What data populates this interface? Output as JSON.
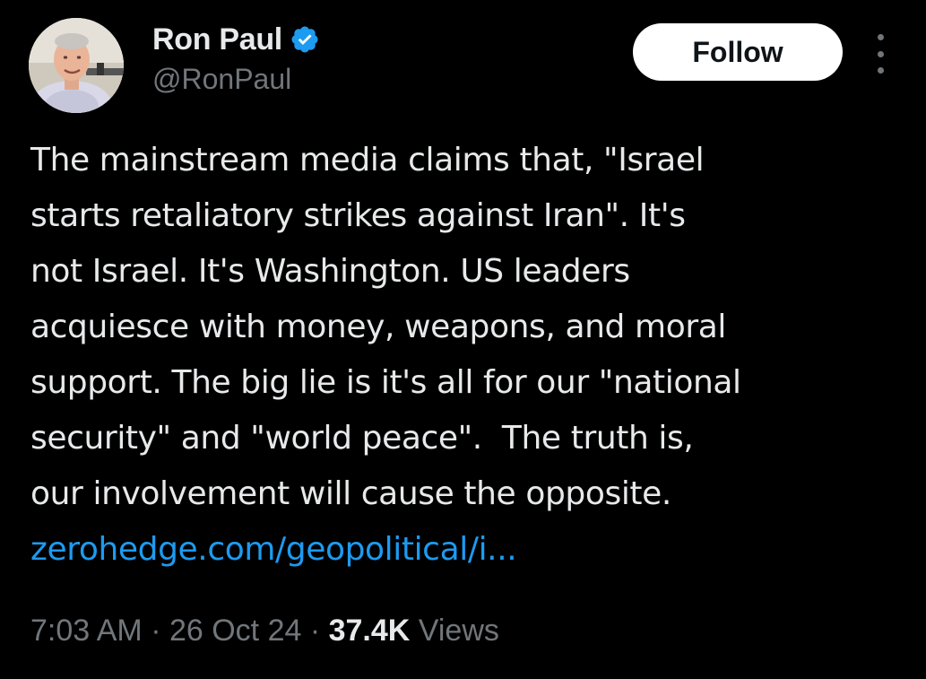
{
  "author": {
    "display_name": "Ron Paul",
    "handle": "@RonPaul",
    "verified": true,
    "verified_color": "#1d9bf0"
  },
  "actions": {
    "follow_label": "Follow",
    "more_icon": "more-vertical-icon"
  },
  "tweet": {
    "lines": [
      "The mainstream media claims that, \"Israel",
      "starts retaliatory strikes against Iran\". It's",
      "not Israel. It's Washington. US leaders",
      "acquiesce with money, weapons, and moral",
      "support. The big lie is it's all for our \"national",
      "security\" and \"world peace\".  The truth is,",
      "our involvement will cause the opposite."
    ],
    "link_text": "zerohedge.com/geopolitical/i..."
  },
  "meta": {
    "time": "7:03 AM",
    "separator": " · ",
    "date": "26 Oct 24",
    "views_count": "37.4K",
    "views_label": " Views"
  },
  "colors": {
    "background": "#000000",
    "text_primary": "#e7e9ea",
    "text_secondary": "#71767b",
    "link": "#1d9bf0",
    "follow_bg": "#ffffff"
  }
}
